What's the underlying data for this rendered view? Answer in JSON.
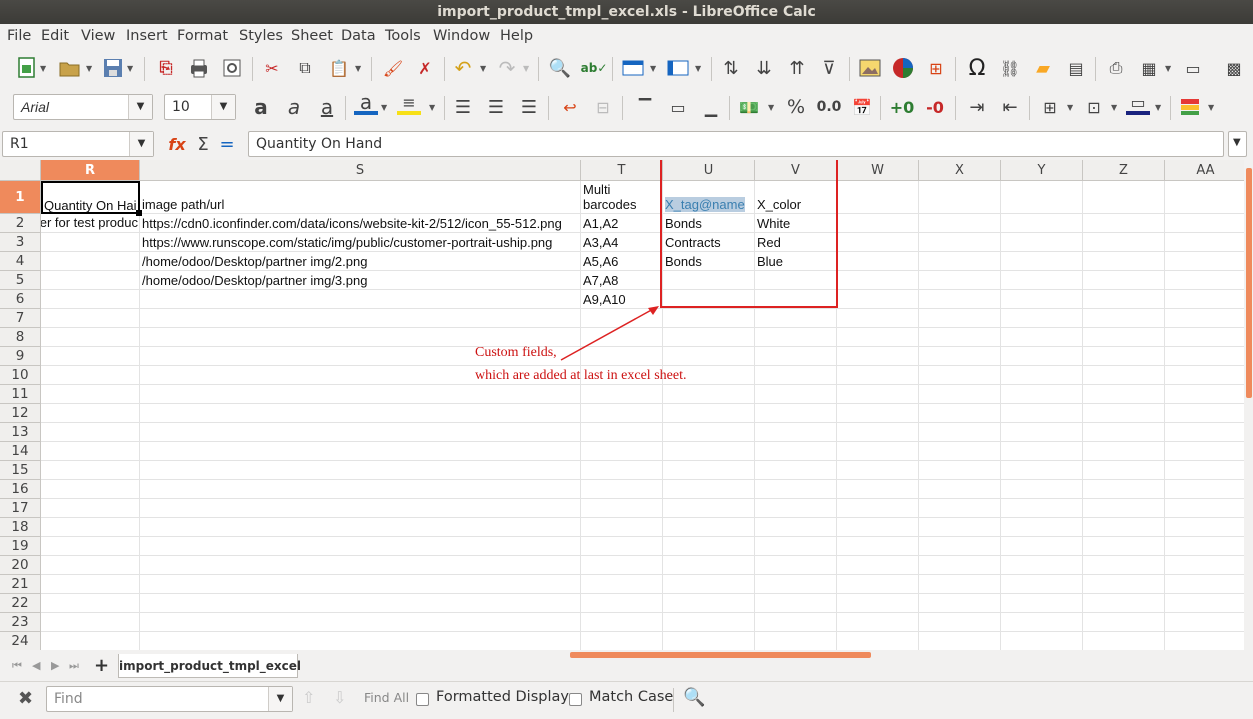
{
  "window": {
    "title": "import_product_tmpl_excel.xls - LibreOffice Calc"
  },
  "menu": [
    "File",
    "Edit",
    "View",
    "Insert",
    "Format",
    "Styles",
    "Sheet",
    "Data",
    "Tools",
    "Window",
    "Help"
  ],
  "toolbar": {
    "font_name": "Arial",
    "font_size": "10",
    "number_percent": "%",
    "number_decimal": "0.0"
  },
  "formula_bar": {
    "name_box": "R1",
    "formula": "Quantity On Hand",
    "icon_function_wizard": "function-wizard-icon",
    "icon_sum": "sum-icon",
    "icon_equals": "equals-icon"
  },
  "columns": [
    "R",
    "S",
    "T",
    "U",
    "V",
    "W",
    "X",
    "Y",
    "Z",
    "AA"
  ],
  "rows": [
    "1",
    "2",
    "3",
    "4",
    "5",
    "6",
    "7",
    "8",
    "9",
    "10",
    "11",
    "12",
    "13",
    "14",
    "15",
    "16",
    "17",
    "18",
    "19",
    "20",
    "21",
    "22",
    "23",
    "24"
  ],
  "cells": {
    "R1": "Quantity On Hai",
    "R2": "er for test produc",
    "S1": "image path/url",
    "S2": "https://cdn0.iconfinder.com/data/icons/website-kit-2/512/icon_55-512.png",
    "S3": "https://www.runscope.com/static/img/public/customer-portrait-uship.png",
    "S4": "/home/odoo/Desktop/partner img/2.png",
    "S5": "/home/odoo/Desktop/partner img/3.png",
    "T1a": "Multi",
    "T1b": "barcodes",
    "T2": "A1,A2",
    "T3": "A3,A4",
    "T4": "A5,A6",
    "T5": "A7,A8",
    "T6": "A9,A10",
    "U1": "X_tag@name",
    "U2": "Bonds",
    "U3": "Contracts",
    "U4": "Bonds",
    "V1": "X_color",
    "V2": "White",
    "V3": "Red",
    "V4": "Blue"
  },
  "annotation": {
    "line1": "Custom fields,",
    "line2": "which are added at last in excel sheet.",
    "color": "#cc1111"
  },
  "sheet_tabs": {
    "active": "import_product_tmpl_excel"
  },
  "find_bar": {
    "placeholder": "Find",
    "find_all": "Find All",
    "formatted_display": "Formatted Display",
    "match_case": "Match Case"
  },
  "colors": {
    "selection_header": "#ef8a5c",
    "accent_red": "#dd2222"
  }
}
